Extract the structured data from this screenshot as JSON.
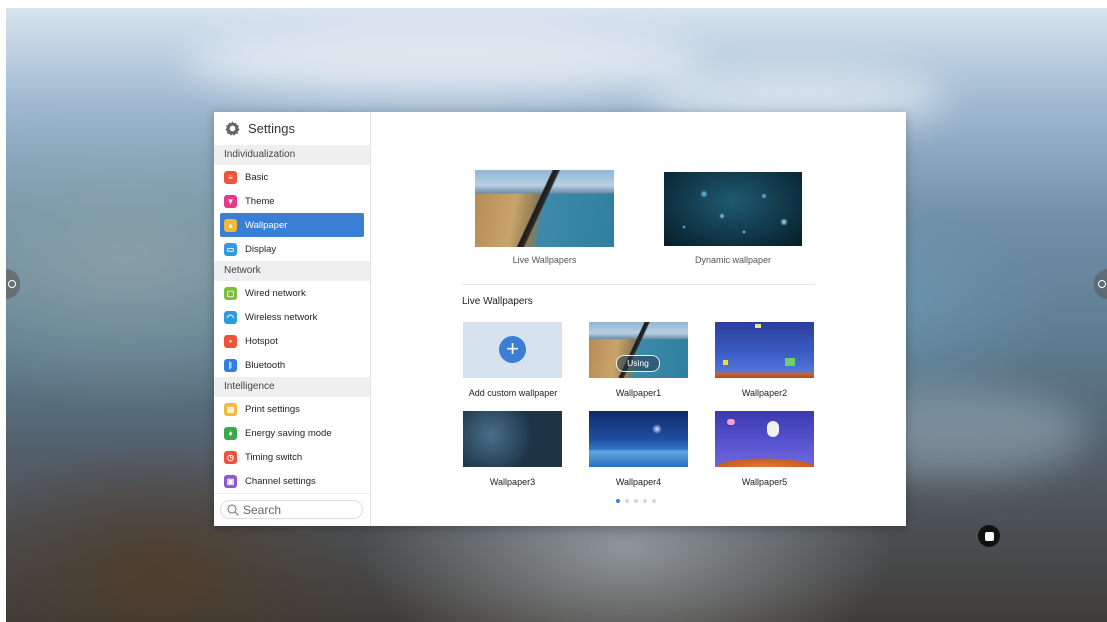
{
  "app": {
    "title": "Settings"
  },
  "sidebar": {
    "sections": [
      {
        "label": "Individualization",
        "items": [
          {
            "label": "Basic",
            "color": "#f0533a"
          },
          {
            "label": "Theme",
            "color": "#e8398c"
          },
          {
            "label": "Wallpaper",
            "color": "#f5b93a",
            "active": true
          },
          {
            "label": "Display",
            "color": "#2e9be0"
          }
        ]
      },
      {
        "label": "Network",
        "items": [
          {
            "label": "Wired network",
            "color": "#7cbd3a"
          },
          {
            "label": "Wireless network",
            "color": "#2e9be0"
          },
          {
            "label": "Hotspot",
            "color": "#f0533a"
          },
          {
            "label": "Bluetooth",
            "color": "#2e7fe0"
          }
        ]
      },
      {
        "label": "Intelligence",
        "items": [
          {
            "label": "Print settings",
            "color": "#f5b93a"
          },
          {
            "label": "Energy saving mode",
            "color": "#3aa94a"
          },
          {
            "label": "Timing switch",
            "color": "#f0533a"
          },
          {
            "label": "Channel settings",
            "color": "#8a5ad0"
          }
        ]
      }
    ],
    "search_placeholder": "Search"
  },
  "main": {
    "categories": [
      {
        "label": "Live Wallpapers"
      },
      {
        "label": "Dynamic wallpaper"
      }
    ],
    "section_title": "Live Wallpapers",
    "grid": [
      {
        "label": "Add custom wallpaper"
      },
      {
        "label": "Wallpaper1",
        "badge": "Using"
      },
      {
        "label": "Wallpaper2"
      },
      {
        "label": "Wallpaper3"
      },
      {
        "label": "Wallpaper4"
      },
      {
        "label": "Wallpaper5"
      }
    ],
    "pagination": {
      "pages": 5,
      "current": 1
    }
  },
  "colors": {
    "accent": "#3a7fd5"
  }
}
